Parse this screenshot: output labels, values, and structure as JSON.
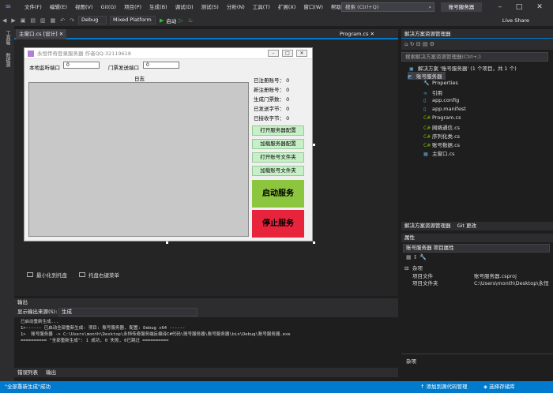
{
  "menubar": {
    "items": [
      "文件(F)",
      "编辑(E)",
      "视图(V)",
      "Git(G)",
      "项目(P)",
      "生成(B)",
      "调试(D)",
      "测试(S)",
      "分析(N)",
      "工具(T)",
      "扩展(X)",
      "窗口(W)",
      "帮助(H)"
    ],
    "search_placeholder": "搜索 (Ctrl+Q)",
    "project_name": "账号服务器"
  },
  "toolbar": {
    "config": "Debug",
    "platform": "Mixed Platform",
    "start_label": "启动",
    "live_share": "Live Share"
  },
  "left_strip": {
    "toolbox": "工具箱",
    "datasource": "数据源"
  },
  "tabs": {
    "designer": "主窗口.cs [设计]",
    "program": "Program.cs"
  },
  "form": {
    "title": "永恒传奇登录服务器 作者QQ:32119618",
    "local_port_label": "本地监听端口",
    "local_port_value": "0",
    "gate_port_label": "门票发送端口",
    "gate_port_value": "0",
    "log_label": "日志",
    "stats": [
      "已注册账号： 0",
      "新注册账号： 0",
      "生成门票数： 0",
      "已发送字节： 0",
      "已接收字节： 0"
    ],
    "buttons": [
      "打开服务器配置",
      "加载服务器配置",
      "打开账号文件夹",
      "加载账号文件夹"
    ],
    "start_button": "启动服务",
    "stop_button": "停止服务"
  },
  "tray": {
    "minimize_tray": "最小化到托盘",
    "tray_menu": "托盘右键菜单"
  },
  "output": {
    "header": "输出",
    "source_label": "显示输出来源(S):",
    "source_value": "生成",
    "lines": [
      "已启动重新生成...",
      "1>------ 已启动全部重新生成: 项目: 账号服务器, 配置: Debug x64 ------",
      "1>  账号服务器 -> C:\\Users\\month\\Desktop\\永恒传奇服务端反编译C#代码\\账号服务器\\账号服务器\\bin\\Debug\\账号服务器.exe",
      "========== \"全部重新生成\": 1 成功, 0 失败, 0已跳过 =========="
    ]
  },
  "bottom_tabs": [
    "错误列表",
    "输出"
  ],
  "statusbar": {
    "text": "\"全部重新生成\"成功",
    "source_control": "添加到源代码管理",
    "repo": "选择存储库"
  },
  "solution_explorer": {
    "header": "解决方案资源管理器",
    "search_placeholder": "搜索解决方案资源管理器(Ctrl+;)",
    "solution": "解决方案 '账号服务器' (1 个项目，共 1 个)",
    "project": "账号服务器",
    "items": [
      "Properties",
      "引用",
      "app.config",
      "app.manifest",
      "Program.cs",
      "网络通信.cs",
      "序列化类.cs",
      "账号数据.cs",
      "主窗口.cs"
    ],
    "tabs": [
      "解决方案资源管理器",
      "Git 更改"
    ]
  },
  "properties": {
    "header": "属性",
    "object": "账号服务器 项目属性",
    "category": "杂项",
    "rows": [
      {
        "key": "项目文件",
        "value": "账号服务器.csproj"
      },
      {
        "key": "项目文件夹",
        "value": "C:\\Users\\month\\Desktop\\永恒"
      }
    ],
    "desc": "杂项"
  }
}
